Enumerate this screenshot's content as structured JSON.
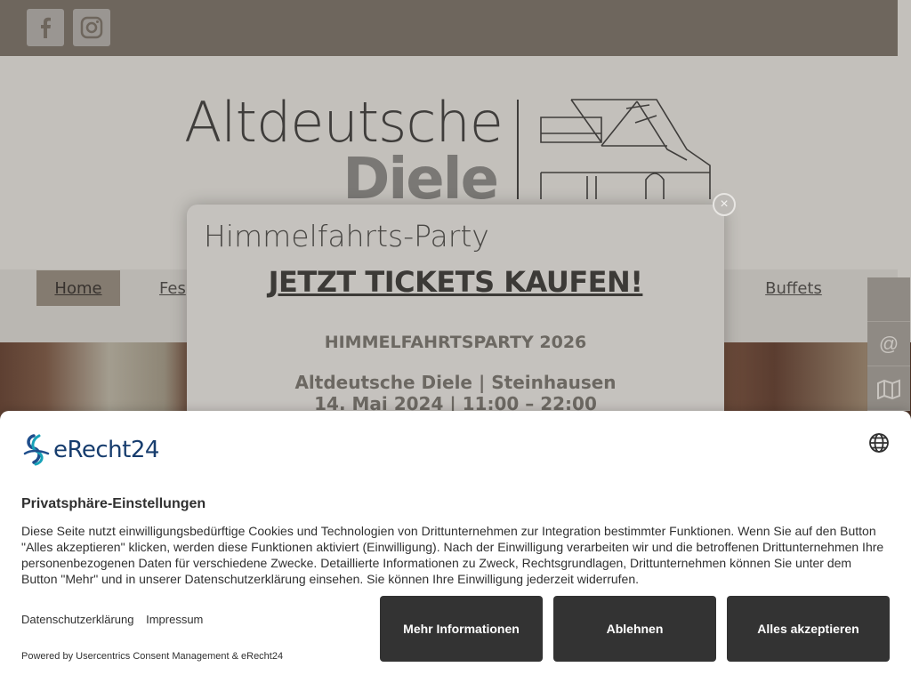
{
  "site": {
    "social": [
      {
        "icon": "facebook-icon"
      },
      {
        "icon": "instagram-icon"
      }
    ],
    "logo": {
      "line1": "Altdeutsche",
      "line2": "Diele"
    },
    "nav": {
      "home": "Home",
      "feste": "Fes",
      "buffets": "Buffets"
    },
    "side_tools": [
      "at-icon",
      "map-icon"
    ]
  },
  "popup": {
    "title": "Himmelfahrts-Party",
    "cta": "JETZT TICKETS KAUFEN!",
    "event": "HIMMELFAHRTSPARTY 2026",
    "location": "Altdeutsche Diele | Steinhausen",
    "date": "14. Mai 2024 | 11:00 – 22:00",
    "close_symbol": "×"
  },
  "consent": {
    "brand": "eRecht24",
    "title": "Privatsphäre-Einstellungen",
    "body": "Diese Seite nutzt einwilligungsbedürftige Cookies und Technologien von Drittunternehmen zur Integration bestimmter Funktionen. Wenn Sie auf den Button \"Alles akzeptieren\" klicken, werden diese Funktionen aktiviert (Einwilligung). Nach der Einwilligung verarbeiten wir und die betroffenen Drittunternehmen Ihre personenbezogenen Daten für verschiedene Zwecke. Detaillierte Informationen zu Zweck, Rechtsgrundlagen, Drittunternehmen können Sie unter dem Button \"Mehr\" und in unserer Datenschutzerklärung einsehen. Sie können Ihre Einwilligung jederzeit widerrufen.",
    "links": {
      "privacy": "Datenschutzerklärung",
      "imprint": "Impressum"
    },
    "powered": "Powered by Usercentrics Consent Management & eRecht24",
    "buttons": {
      "more": "Mehr Informationen",
      "deny": "Ablehnen",
      "accept": "Alles akzeptieren"
    },
    "colors": {
      "button_bg": "#333333",
      "brand": "#173d6e"
    }
  }
}
